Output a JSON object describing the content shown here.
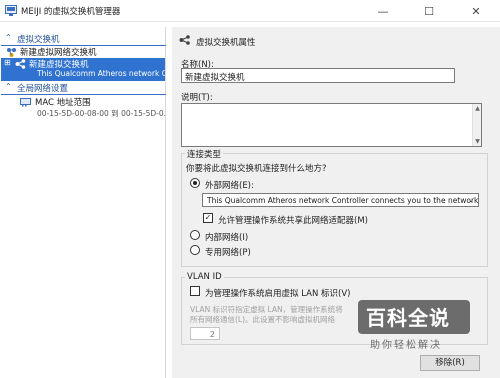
{
  "window": {
    "title": "MEIJI 的虚拟交换机管理器",
    "minimize": "—",
    "maximize": "☐",
    "close": "✕"
  },
  "tree": {
    "section1": {
      "chevron": "⌃",
      "label": "虚拟交换机"
    },
    "new_switch": {
      "label": "新建虚拟网络交换机"
    },
    "switch_item": {
      "expander": "⊞",
      "label": "新建虚拟交换机",
      "sub": "This Qualcomm Atheros network C..."
    },
    "section2": {
      "chevron": "⌃",
      "label": "全局网络设置"
    },
    "mac_range": {
      "label": "MAC 地址范围",
      "sub": "00-15-5D-00-08-00 到 00-15-5D-0..."
    }
  },
  "properties": {
    "header": "虚拟交换机属性",
    "name_label": "名称(N):",
    "name_value": "新建虚拟交换机",
    "notes_label": "说明(T):",
    "conn_group_title": "连接类型",
    "conn_question": "你要将此虚拟交换机连接到什么地方?",
    "external_label": "外部网络(E):",
    "adapter_value": "This Qualcomm Atheros network Controller connects you to the network.",
    "allow_mgmt_label": "允许管理操作系统共享此网络适配器(M)",
    "internal_label": "内部网络(I)",
    "private_label": "专用网络(P)",
    "vlan_group_title": "VLAN ID",
    "vlan_enable_label": "为管理操作系统启用虚拟 LAN 标识(V)",
    "vlan_desc1": "VLAN 标识符指定虚拟 LAN，管理操作系统将",
    "vlan_desc2": "所有网络通信(L)。此设置不影响虚拟机网络",
    "vlan_value": "2",
    "remove_button": "移除(R)"
  },
  "watermark": {
    "main": "百科全说",
    "sub": "助你轻松解决"
  },
  "colors": {
    "accent": "#2f72d0",
    "section_text": "#1f4f9a",
    "pane_bg": "#f0f0f0"
  }
}
